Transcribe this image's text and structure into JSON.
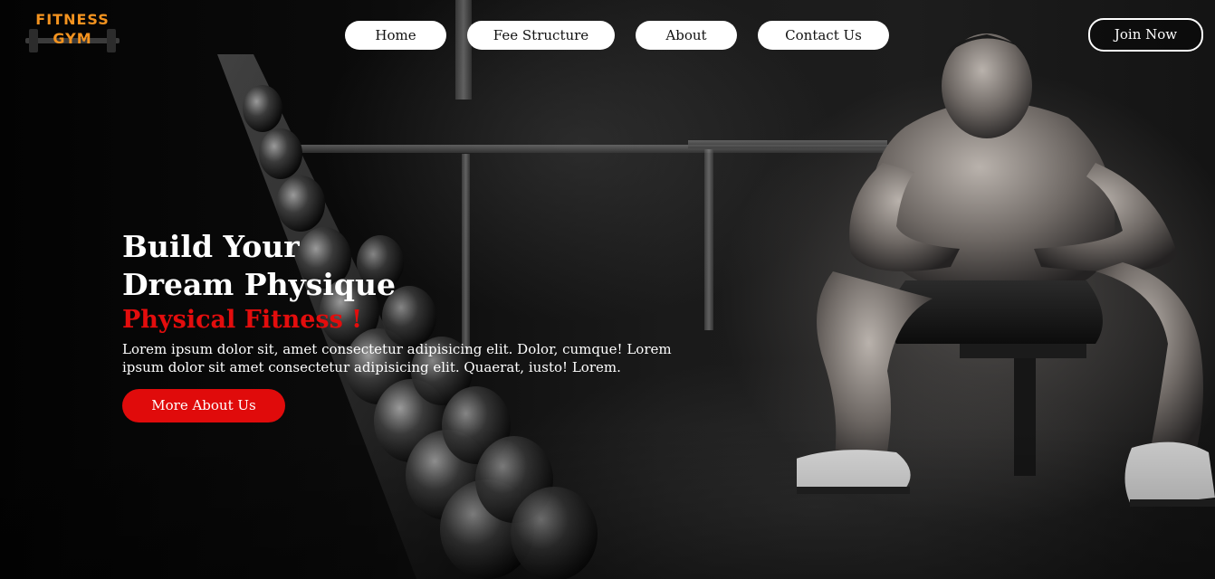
{
  "logo": {
    "line1": "FITNESS",
    "line2": "GYM",
    "icon": "dumbbell-icon",
    "color": "#f4931f"
  },
  "nav": {
    "items": [
      {
        "label": "Home"
      },
      {
        "label": "Fee Structure"
      },
      {
        "label": "About"
      },
      {
        "label": "Contact Us"
      }
    ]
  },
  "header": {
    "join_label": "Join Now"
  },
  "hero": {
    "title_line1": "Build Your",
    "title_line2": "Dream Physique",
    "accent": "Physical Fitness !",
    "description": "Lorem ipsum dolor sit, amet consectetur adipisicing elit. Dolor, cumque! Lorem ipsum dolor sit amet consectetur adipisicing elit. Quaerat, iusto! Lorem.",
    "cta_label": "More About Us"
  },
  "colors": {
    "accent_red": "#e00b0b",
    "logo_orange": "#f4931f",
    "nav_bg": "#ffffff",
    "page_bg": "#050505"
  }
}
